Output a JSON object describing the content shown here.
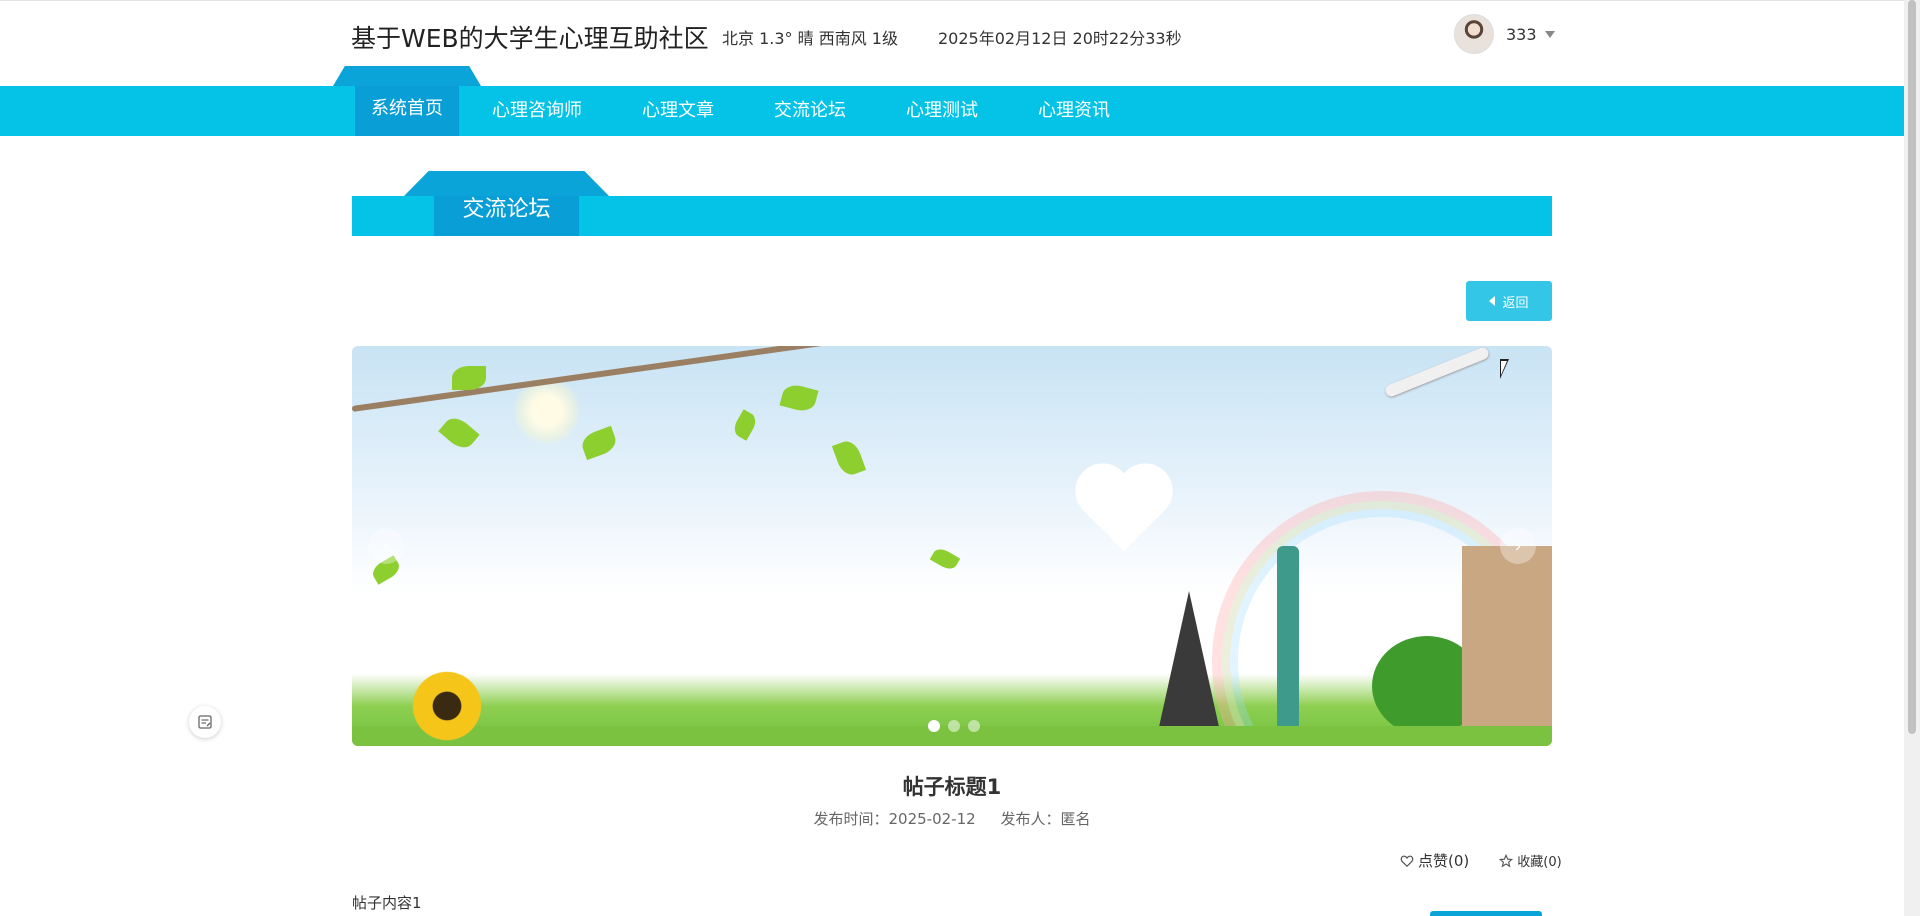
{
  "header": {
    "site_title": "基于WEB的大学生心理互助社区",
    "weather": "北京  1.3°  晴  西南风  1级",
    "datetime": "2025年02月12日 20时22分33秒",
    "user_name": "333"
  },
  "nav": {
    "home": "系统首页",
    "items": [
      "心理咨询师",
      "心理文章",
      "交流论坛",
      "心理测试",
      "心理资讯"
    ]
  },
  "section": {
    "title": "交流论坛"
  },
  "back_button": {
    "label": "返回"
  },
  "carousel": {
    "prev": "‹",
    "next": "›",
    "slide_count": 3,
    "active_index": 0
  },
  "post": {
    "title": "帖子标题1",
    "publish_time": "发布时间：2025-02-12",
    "publisher": "发布人：匿名",
    "like_label": "点赞(0)",
    "favorite_label": "收藏(0)",
    "content": "帖子内容1"
  },
  "colors": {
    "nav_bg": "#05c3e6",
    "tab_active": "#0a9ed6",
    "button_bg": "#34c6e6"
  }
}
